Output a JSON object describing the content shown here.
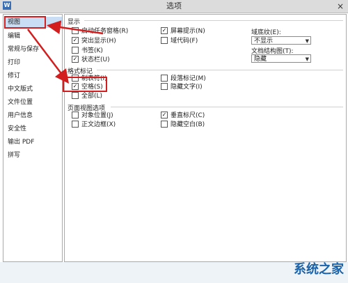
{
  "window": {
    "app_icon_label": "W",
    "title": "选项",
    "close_label": "×"
  },
  "sidebar": {
    "items": [
      {
        "label": "视图",
        "selected": true
      },
      {
        "label": "编辑"
      },
      {
        "label": "常规与保存"
      },
      {
        "label": "打印"
      },
      {
        "label": "修订"
      },
      {
        "label": "中文版式"
      },
      {
        "label": "文件位置"
      },
      {
        "label": "用户信息"
      },
      {
        "label": "安全性"
      },
      {
        "label": "输出 PDF"
      },
      {
        "label": "拼写"
      }
    ]
  },
  "sections": {
    "display": {
      "title": "显示",
      "checkboxes": [
        {
          "label": "启动任务窗格(R)",
          "checked": false
        },
        {
          "label": "突出显示(H)",
          "checked": true
        },
        {
          "label": "书签(K)",
          "checked": false
        },
        {
          "label": "状态栏(U)",
          "checked": true
        },
        {
          "label": "屏幕提示(N)",
          "checked": true
        },
        {
          "label": "域代码(F)",
          "checked": false
        }
      ],
      "field_shading_label": "域底纹(E):",
      "field_shading_value": "不显示",
      "doc_map_label": "文档结构图(T):",
      "doc_map_value": "隐藏"
    },
    "format_marks": {
      "title": "格式标记",
      "checkboxes": [
        {
          "label": "制表符(I)",
          "checked": false
        },
        {
          "label": "空格(S)",
          "checked": true
        },
        {
          "label": "全部(L)",
          "checked": false
        },
        {
          "label": "段落标记(M)",
          "checked": false
        },
        {
          "label": "隐藏文字(I)",
          "checked": false
        }
      ]
    },
    "page_view": {
      "title": "页面视图选项",
      "checkboxes": [
        {
          "label": "对象位置(J)",
          "checked": false
        },
        {
          "label": "正文边框(X)",
          "checked": false
        },
        {
          "label": "垂直标尺(C)",
          "checked": true
        },
        {
          "label": "隐藏空白(B)",
          "checked": false
        }
      ]
    }
  },
  "watermark": {
    "text": "系统之家"
  },
  "colors": {
    "highlight_red": "#d21e1e",
    "selected_bg": "#c9def5"
  }
}
